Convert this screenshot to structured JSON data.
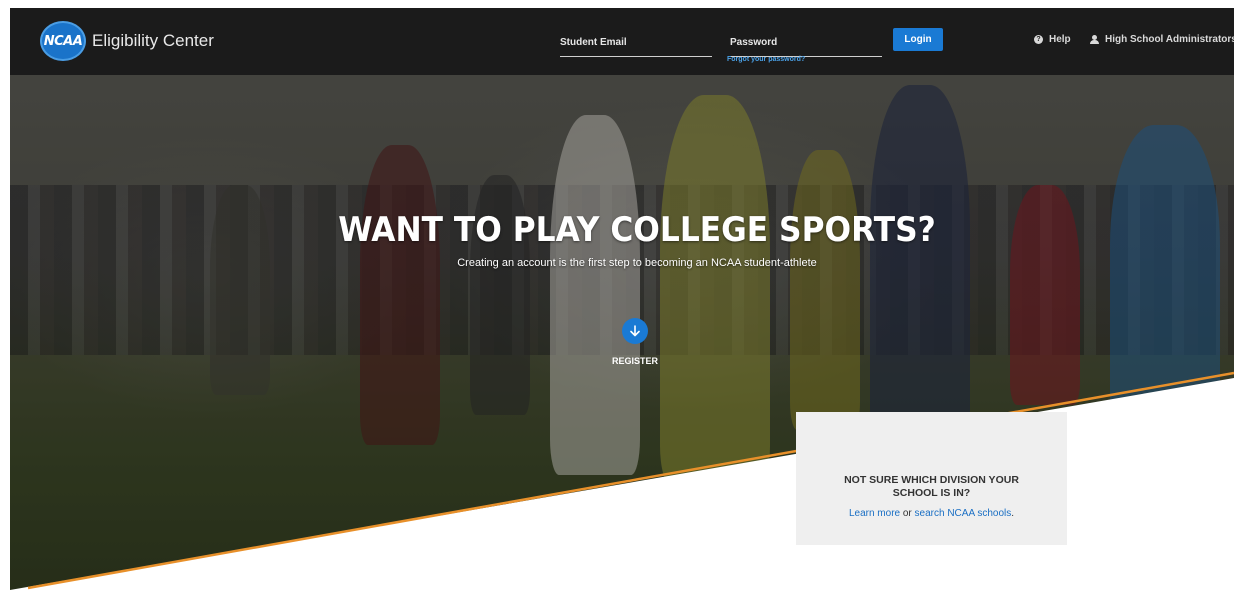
{
  "header": {
    "logo_badge": "NCAA",
    "logo_text": "Eligibility Center",
    "email_placeholder": "Student Email",
    "password_placeholder": "Password",
    "forgot_password": "Forgot your password?",
    "login_label": "Login",
    "help_label": "Help",
    "admin_label": "High School Administrators"
  },
  "hero": {
    "title": "WANT TO PLAY COLLEGE SPORTS?",
    "subtitle": "Creating an account is the first step to becoming an NCAA student-athlete",
    "register_label": "REGISTER"
  },
  "division": {
    "title": "NOT SURE WHICH DIVISION YOUR SCHOOL IS IN?",
    "learn_more": "Learn more",
    "or_text": " or ",
    "search_link": "search NCAA schools",
    "period": "."
  },
  "colors": {
    "header_bg": "#1b1b1b",
    "accent_blue": "#1a7ad4",
    "orange_line": "#e8902a",
    "division_box_bg": "#efefef"
  }
}
